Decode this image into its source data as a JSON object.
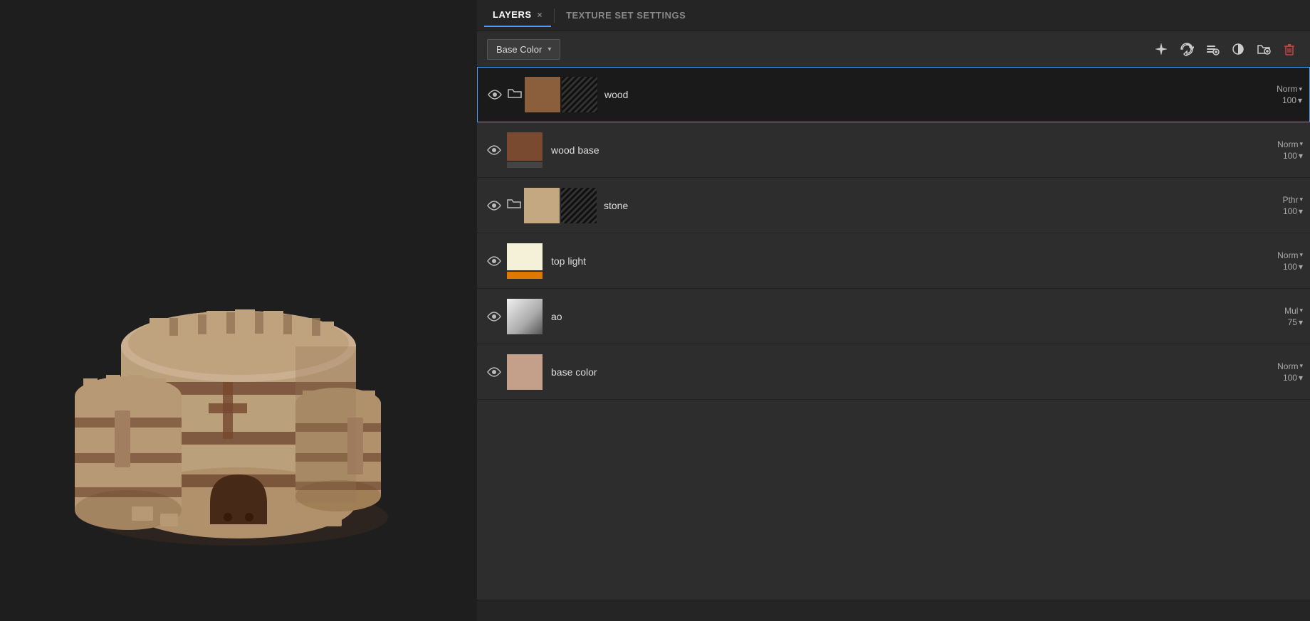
{
  "tabs": {
    "layers_label": "LAYERS",
    "layers_close": "×",
    "texture_set_label": "TEXTURE SET SETTINGS"
  },
  "toolbar": {
    "channel_dropdown": "Base Color",
    "channel_dropdown_arrow": "▾",
    "tools": [
      {
        "name": "add-fill-layer",
        "icon": "✳",
        "tooltip": "Add fill layer"
      },
      {
        "name": "add-layer",
        "icon": "⧉",
        "tooltip": "Add paint layer"
      },
      {
        "name": "add-folder",
        "icon": "⊞",
        "tooltip": "Add folder"
      },
      {
        "name": "add-mask",
        "icon": "◑",
        "tooltip": "Add mask"
      },
      {
        "name": "new-folder",
        "icon": "⊡",
        "tooltip": "New folder"
      },
      {
        "name": "delete-layer",
        "icon": "🗑",
        "tooltip": "Delete layer"
      }
    ]
  },
  "layers": [
    {
      "id": "wood",
      "name": "wood",
      "visible": true,
      "hasFolder": true,
      "thumbColor": "#8b5e3c",
      "thumbBarColor": null,
      "hasMask": true,
      "blendMode": "Norm",
      "opacity": "100",
      "selected": true
    },
    {
      "id": "wood-base",
      "name": "wood base",
      "visible": true,
      "hasFolder": false,
      "thumbColor": "#7a4a30",
      "thumbBarColor": null,
      "hasMask": false,
      "blendMode": "Norm",
      "opacity": "100",
      "selected": false
    },
    {
      "id": "stone",
      "name": "stone",
      "visible": true,
      "hasFolder": true,
      "thumbColor": "#c4a882",
      "thumbBarColor": null,
      "hasMask": true,
      "blendMode": "Pthr",
      "opacity": "100",
      "selected": false
    },
    {
      "id": "top-light",
      "name": "top light",
      "visible": true,
      "hasFolder": false,
      "thumbColor": "#f5f0d8",
      "thumbBarColor": "#e07800",
      "hasMask": false,
      "blendMode": "Norm",
      "opacity": "100",
      "selected": false
    },
    {
      "id": "ao",
      "name": "ao",
      "visible": true,
      "hasFolder": false,
      "thumbColor": null,
      "thumbBarColor": null,
      "isAO": true,
      "hasMask": false,
      "blendMode": "Mul",
      "opacity": "75",
      "selected": false
    },
    {
      "id": "base-color",
      "name": "base color",
      "visible": true,
      "hasFolder": false,
      "thumbColor": "#c4a08a",
      "thumbBarColor": null,
      "hasMask": false,
      "blendMode": "Norm",
      "opacity": "100",
      "selected": false
    }
  ],
  "colors": {
    "accent_blue": "#4a9eff",
    "panel_bg": "#2d2d2d",
    "selected_bg": "#1a1a1a",
    "tab_bg": "#252525"
  }
}
